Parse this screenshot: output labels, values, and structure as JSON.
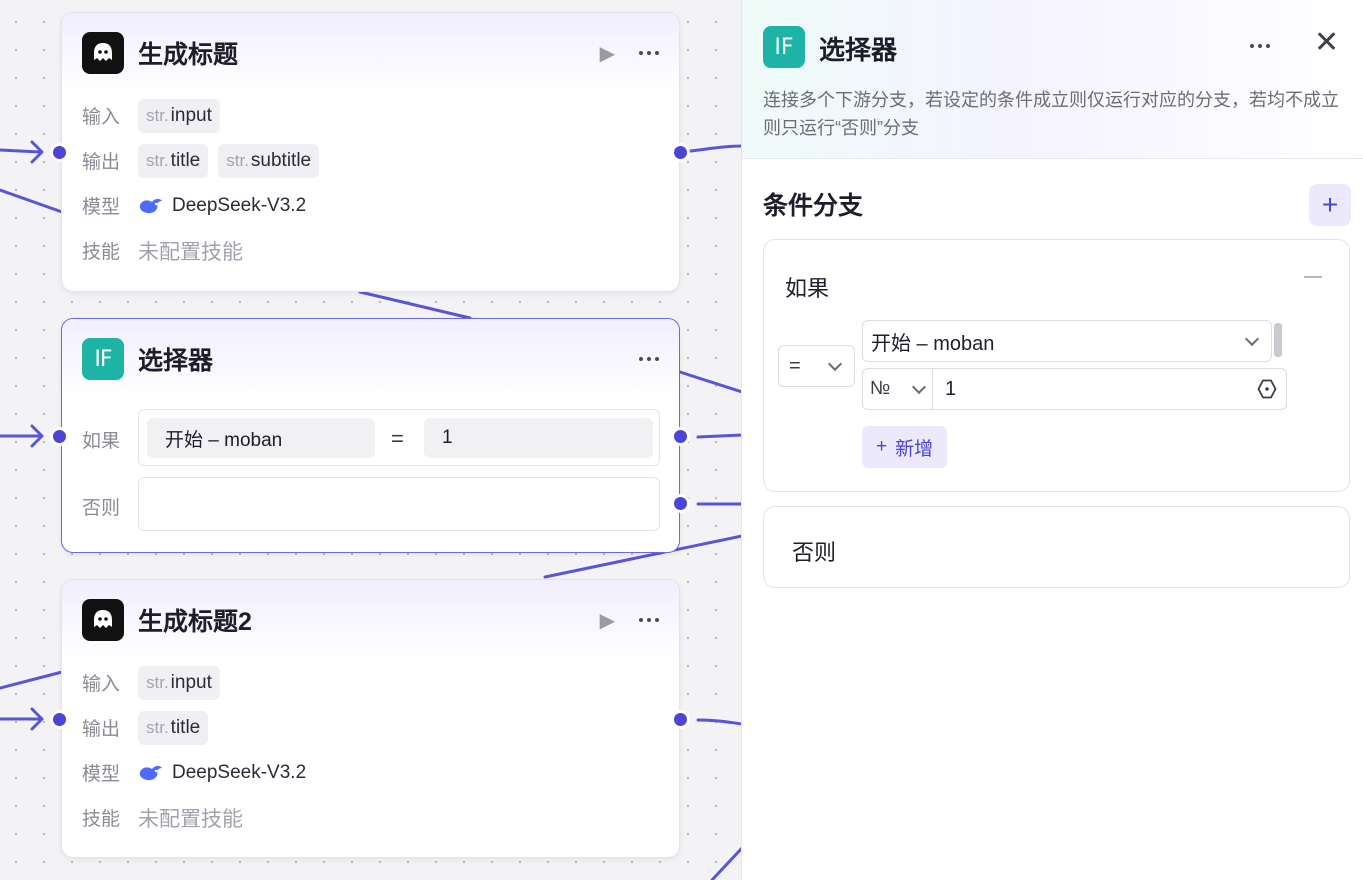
{
  "nodes": {
    "gen_title": {
      "title": "生成标题",
      "input_label": "输入",
      "output_label": "输出",
      "model_label": "模型",
      "skill_label": "技能",
      "inputs": [
        {
          "type": "str.",
          "name": "input"
        }
      ],
      "outputs": [
        {
          "type": "str.",
          "name": "title"
        },
        {
          "type": "str.",
          "name": "subtitle"
        }
      ],
      "model": "DeepSeek-V3.2",
      "skill": "未配置技能"
    },
    "selector": {
      "title": "选择器",
      "icon_text": "IF",
      "if_label": "如果",
      "else_label": "否则",
      "cond_var": "开始  –  moban",
      "cond_op": "=",
      "cond_val": "1"
    },
    "gen_title2": {
      "title": "生成标题2",
      "input_label": "输入",
      "output_label": "输出",
      "model_label": "模型",
      "skill_label": "技能",
      "inputs": [
        {
          "type": "str.",
          "name": "input"
        }
      ],
      "outputs": [
        {
          "type": "str.",
          "name": "title"
        }
      ],
      "model": "DeepSeek-V3.2",
      "skill": "未配置技能"
    }
  },
  "panel": {
    "icon_text": "IF",
    "title": "选择器",
    "description": "连接多个下游分支，若设定的条件成立则仅运行对应的分支，若均不成立则只运行“否则”分支",
    "section_title": "条件分支",
    "if_card": {
      "label": "如果",
      "operator": "=",
      "variable": "开始 – moban",
      "value_type": "№",
      "value": "1",
      "add_label": "新增"
    },
    "else_card": {
      "label": "否则"
    }
  },
  "colors": {
    "accent": "#4a45d6",
    "if_icon": "#1db3a5",
    "edge": "#5a55d6"
  },
  "icons": [
    "llm-robot-icon",
    "play-icon",
    "more-icon",
    "if-icon",
    "deepseek-whale-icon",
    "close-icon",
    "plus-icon",
    "minus-icon",
    "chevron-down-icon",
    "variable-icon"
  ]
}
